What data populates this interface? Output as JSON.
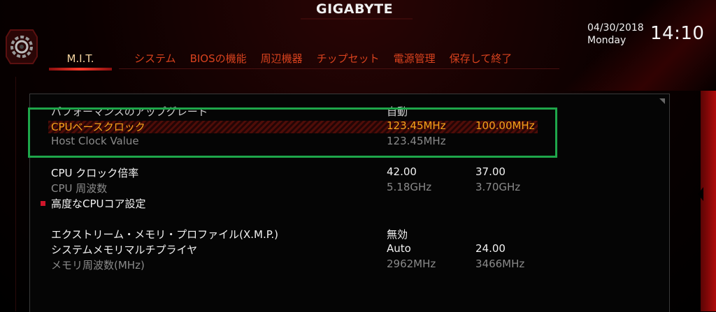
{
  "brand": "GIGABYTE",
  "date": "04/30/2018",
  "weekday": "Monday",
  "time": "14:10",
  "tabs": [
    {
      "label": "M.I.T.",
      "active": true
    },
    {
      "label": "システム",
      "active": false
    },
    {
      "label": "BIOSの機能",
      "active": false
    },
    {
      "label": "周辺機器",
      "active": false
    },
    {
      "label": "チップセット",
      "active": false
    },
    {
      "label": "電源管理",
      "active": false
    },
    {
      "label": "保存して終了",
      "active": false
    }
  ],
  "settings": {
    "performance_upgrade": {
      "label": "パフォーマンスのアップグレード",
      "value": "自動"
    },
    "cpu_base_clock": {
      "label": "CPUベースクロック",
      "value": "123.45MHz",
      "default": "100.00MHz"
    },
    "host_clock_value": {
      "label": "Host Clock Value",
      "value": "123.45MHz"
    },
    "cpu_clock_ratio": {
      "label": "CPU クロック倍率",
      "value": "42.00",
      "default": "37.00"
    },
    "cpu_frequency": {
      "label": "CPU 周波数",
      "value": "5.18GHz",
      "default": "3.70GHz"
    },
    "advanced_cpu_core": {
      "label": "高度なCPUコア設定"
    },
    "xmp": {
      "label": "エクストリーム・メモリ・プロファイル(X.M.P.)",
      "value": "無効"
    },
    "memory_multiplier": {
      "label": "システムメモリマルチプライヤ",
      "value": "Auto",
      "default": "24.00"
    },
    "memory_frequency": {
      "label": "メモリ周波数(MHz)",
      "value": "2962MHz",
      "default": "3466MHz"
    }
  },
  "colors": {
    "accent_red": "#d0152a",
    "selected_orange": "#f6a21a",
    "tab_orange": "#d8421e",
    "annotation_green": "#1ea64a"
  }
}
